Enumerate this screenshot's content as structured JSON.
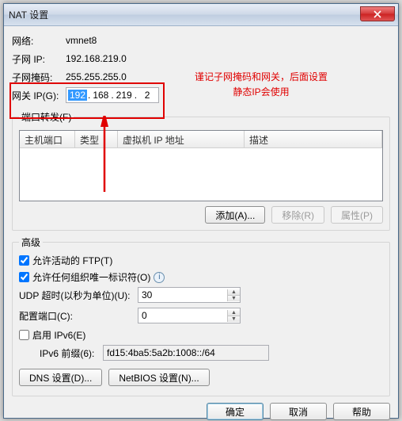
{
  "title": "NAT 设置",
  "network": {
    "label": "网络:",
    "value": "vmnet8"
  },
  "subnet_ip": {
    "label": "子网 IP:",
    "value": "192.168.219.0"
  },
  "subnet_mask": {
    "label": "子网掩码:",
    "value": "255.255.255.0"
  },
  "gateway": {
    "label": "网关 IP(G):",
    "oct1": "192",
    "oct2": "168",
    "oct3": "219",
    "oct4": "2"
  },
  "port_forwarding": {
    "legend": "端口转发(F)",
    "cols": {
      "host_port": "主机端口",
      "type": "类型",
      "vm_ip": "虚拟机 IP 地址",
      "desc": "描述"
    },
    "add": "添加(A)...",
    "remove": "移除(R)",
    "props": "属性(P)"
  },
  "advanced": {
    "legend": "高级",
    "ftp": "允许活动的 FTP(T)",
    "oui": "允许任何组织唯一标识符(O)",
    "udp_label": "UDP 超时(以秒为单位)(U):",
    "udp_value": "30",
    "cfg_port_label": "配置端口(C):",
    "cfg_port_value": "0",
    "ipv6_enable": "启用 IPv6(E)",
    "ipv6_prefix_label": "IPv6 前缀(6):",
    "ipv6_prefix_value": "fd15:4ba5:5a2b:1008::/64",
    "dns_btn": "DNS 设置(D)...",
    "netbios_btn": "NetBIOS 设置(N)..."
  },
  "footer": {
    "ok": "确定",
    "cancel": "取消",
    "help": "帮助"
  },
  "annotation": {
    "line1": "谨记子网掩码和网关，后面设置",
    "line2": "静态IP会使用"
  }
}
